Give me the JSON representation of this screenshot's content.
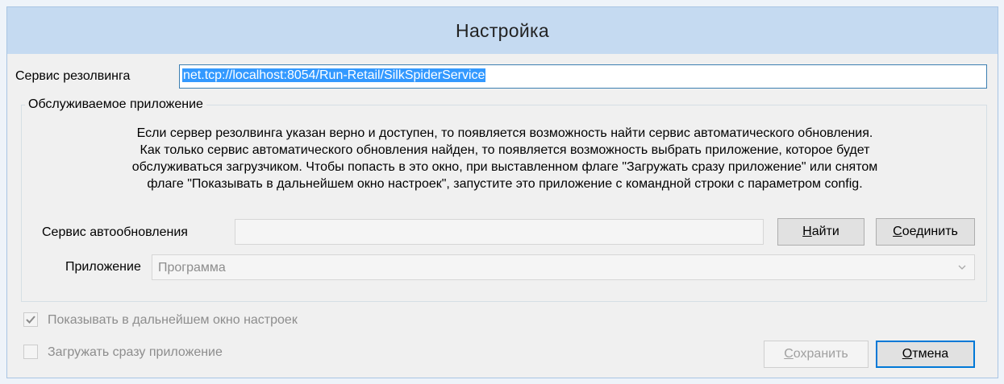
{
  "window": {
    "title": "Настройка"
  },
  "resolve_service": {
    "label": "Сервис резолвинга",
    "value": "net.tcp://localhost:8054/Run-Retail/SilkSpiderService"
  },
  "served_app": {
    "group_title": "Обслуживаемое приложение",
    "description_lines": [
      "Если сервер резолвинга указан верно и доступен, то появляется возможность найти сервис автоматического обновления.",
      "Как только сервис автоматического обновления найден, то появляется возможность выбрать приложение, которое будет",
      "обслуживаться загрузчиком. Чтобы попасть в это окно, при выставленном флаге \"Загружать сразу приложение\" или снятом",
      "флаге \"Показывать в дальнейшем окно настроек\", запустите это приложение с командной строки с параметром config."
    ],
    "autoupdate_label": "Сервис автообновления",
    "autoupdate_value": "",
    "find_button": {
      "accel": "Н",
      "rest": "айти"
    },
    "connect_button": {
      "accel": "С",
      "rest": "оединить"
    },
    "app_label": "Приложение",
    "app_selected": "Программа"
  },
  "options": {
    "show_settings": {
      "label": "Показывать в дальнейшем окно настроек",
      "checked": true
    },
    "load_immediately": {
      "label": "Загружать сразу приложение",
      "checked": false
    }
  },
  "buttons": {
    "save": {
      "accel": "С",
      "rest": "охранить"
    },
    "cancel": {
      "accel": "О",
      "rest": "тмена"
    }
  },
  "icons": {
    "check": "checkmark-icon",
    "dropdown": "chevron-down-icon"
  }
}
